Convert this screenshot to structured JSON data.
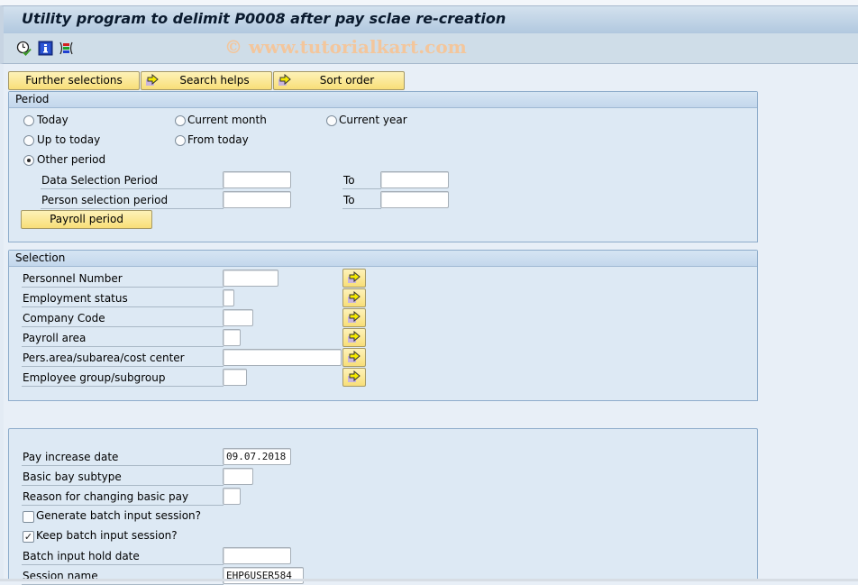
{
  "window": {
    "title": "Utility program to delimit P0008 after pay sclae re-creation",
    "watermark": "© www.tutorialkart.com"
  },
  "toolbar": {
    "icons": [
      {
        "name": "execute-clock-icon",
        "tooltip": "Execute"
      },
      {
        "name": "info-icon",
        "tooltip": "Information"
      },
      {
        "name": "selection-options-icon",
        "tooltip": "Selection options"
      }
    ]
  },
  "top_buttons": {
    "further_selections": "Further selections",
    "search_helps": "Search helps",
    "sort_order": "Sort order"
  },
  "period": {
    "title": "Period",
    "radios": [
      {
        "label": "Today",
        "selected": false
      },
      {
        "label": "Current month",
        "selected": false
      },
      {
        "label": "Current year",
        "selected": false
      },
      {
        "label": "Up to today",
        "selected": false
      },
      {
        "label": "From today",
        "selected": false
      },
      {
        "label": "Other period",
        "selected": true
      }
    ],
    "data_selection_label": "Data Selection Period",
    "data_selection_from": "",
    "data_selection_to": "",
    "person_selection_label": "Person selection period",
    "person_selection_from": "",
    "person_selection_to": "",
    "to_label": "To",
    "payroll_period_button": "Payroll period"
  },
  "selection": {
    "title": "Selection",
    "fields": [
      {
        "label": "Personnel Number",
        "value": ""
      },
      {
        "label": "Employment status",
        "value": ""
      },
      {
        "label": "Company Code",
        "value": ""
      },
      {
        "label": "Payroll area",
        "value": ""
      },
      {
        "label": "Pers.area/subarea/cost center",
        "value": ""
      },
      {
        "label": "Employee group/subgroup",
        "value": ""
      }
    ]
  },
  "parameters": {
    "pay_increase_date_label": "Pay increase date",
    "pay_increase_date": "09.07.2018",
    "basic_pay_subtype_label": "Basic bay subtype",
    "basic_pay_subtype": "",
    "reason_label": "Reason for changing basic pay",
    "reason": "",
    "generate_batch_label": "Generate batch input session?",
    "generate_batch": false,
    "keep_batch_label": "Keep batch input session?",
    "keep_batch": true,
    "keep_batch_mark": "✓",
    "hold_date_label": "Batch input hold date",
    "hold_date": "",
    "session_name_label": "Session name",
    "session_name": "EHP6USER584"
  }
}
